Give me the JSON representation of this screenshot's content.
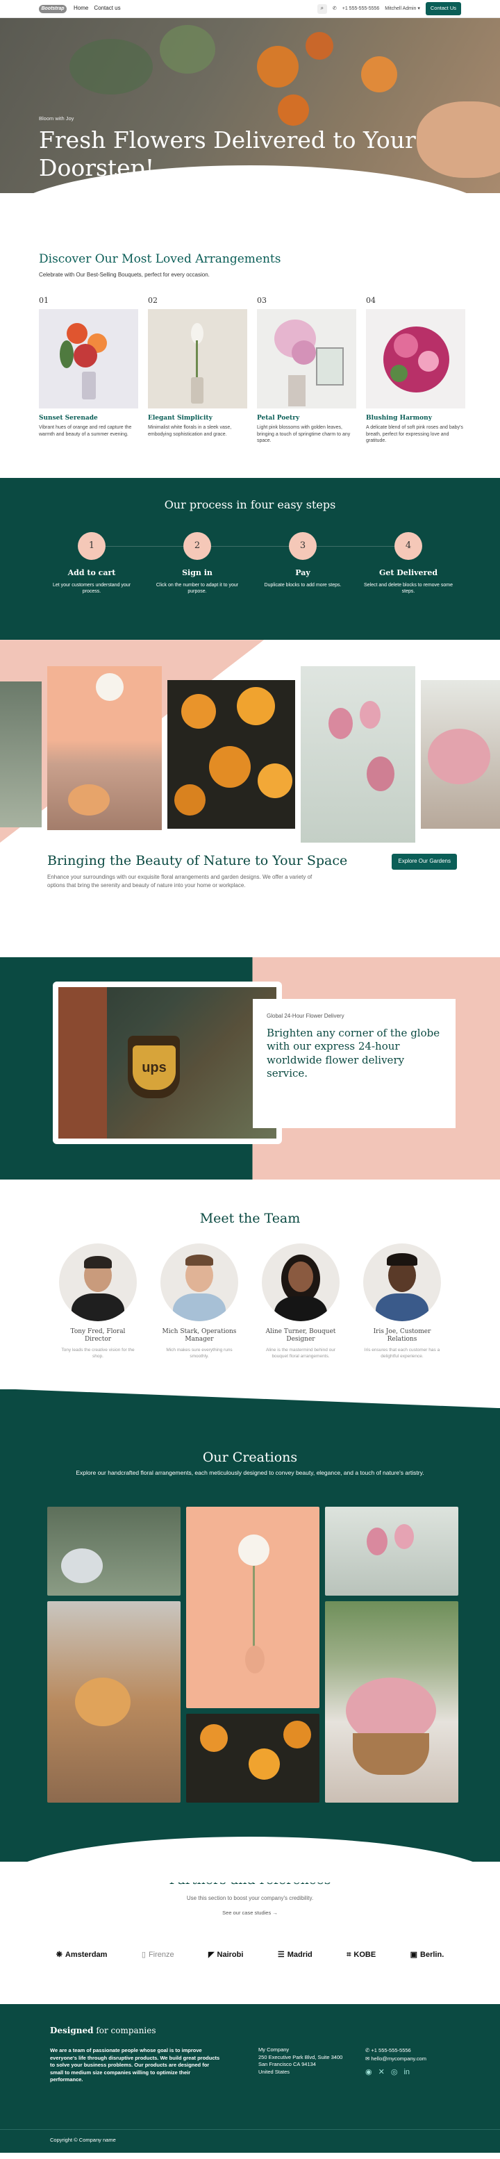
{
  "header": {
    "logo": "Bootstrap",
    "nav": [
      "Home",
      "Contact us"
    ],
    "phone": "+1 555-555-5556",
    "admin": "Mitchell Admin",
    "cta": "Contact Us"
  },
  "hero": {
    "sub": "Bloom with Joy",
    "title": "Fresh Flowers Delivered to Your Doorstep!"
  },
  "arrangements": {
    "title": "Discover Our Most Loved Arrangements",
    "subtitle": "Celebrate with Our Best-Selling Bouquets, perfect for every occasion.",
    "items": [
      {
        "num": "01",
        "title": "Sunset Serenade",
        "desc": "Vibrant hues of orange and red capture the warmth and beauty of a summer evening."
      },
      {
        "num": "02",
        "title": "Elegant Simplicity",
        "desc": "Minimalist white florals in a sleek vase, embodying sophistication and grace."
      },
      {
        "num": "03",
        "title": "Petal Poetry",
        "desc": "Light pink blossoms with golden leaves, bringing a touch of springtime charm to any space."
      },
      {
        "num": "04",
        "title": "Blushing Harmony",
        "desc": "A delicate blend of soft pink roses and baby's breath, perfect for expressing love and gratitude."
      }
    ]
  },
  "process": {
    "title": "Our process in four easy steps",
    "steps": [
      {
        "n": "1",
        "title": "Add to cart",
        "desc": "Let your customers understand your process."
      },
      {
        "n": "2",
        "title": "Sign in",
        "desc": "Click on the number to adapt it to your purpose."
      },
      {
        "n": "3",
        "title": "Pay",
        "desc": "Duplicate blocks to add more steps."
      },
      {
        "n": "4",
        "title": "Get Delivered",
        "desc": "Select and delete blocks to remove some steps."
      }
    ]
  },
  "beauty": {
    "title": "Bringing the Beauty of Nature to Your Space",
    "text": "Enhance your surroundings with our exquisite floral arrangements and garden designs. We offer a variety of options that bring the serenity and beauty of nature into your home or workplace.",
    "button": "Explore Our Gardens"
  },
  "delivery": {
    "small": "Global 24-Hour Flower Delivery",
    "big": "Brighten any corner of the globe with our express 24-hour worldwide flower delivery service.",
    "sign": "ups"
  },
  "team": {
    "title": "Meet the Team",
    "members": [
      {
        "name": "Tony Fred, Floral Director",
        "role": "Tony leads the creative vision for the shop."
      },
      {
        "name": "Mich Stark, Operations Manager",
        "role": "Mich makes sure everything runs smoothly."
      },
      {
        "name": "Aline Turner, Bouquet Designer",
        "role": "Aline is the mastermind behind our bouquet floral arrangements."
      },
      {
        "name": "Iris Joe, Customer Relations",
        "role": "Iris ensures that each customer has a delightful experience."
      }
    ]
  },
  "creations": {
    "title": "Our Creations",
    "subtitle": "Explore our handcrafted floral arrangements, each meticulously designed to convey beauty, elegance, and a touch of nature's artistry."
  },
  "partners": {
    "title": "Partners and references",
    "subtitle": "Use this section to boost your company's credibility.",
    "link": "See our case studies",
    "logos": [
      "Amsterdam",
      "Firenze",
      "Nairobi",
      "Madrid",
      "KOBE",
      "Berlin."
    ]
  },
  "footer": {
    "brand_bold": "Designed",
    "brand_rest": "for companies",
    "text": "We are a team of passionate people whose goal is to improve everyone's life through disruptive products. We build great products to solve your business problems. Our products are designed for small to medium size companies willing to optimize their performance.",
    "company": "My Company",
    "address1": "250 Executive Park Blvd, Suite 3400",
    "address2": "San Francisco CA 94134",
    "address3": "United States",
    "phone": "+1 555-555-5556",
    "email": "hello@mycompany.com",
    "copyright": "Copyright © Company name"
  },
  "colors": {
    "accent": "#0b5e57",
    "dark": "#0b4a42",
    "peach": "#f5c8b8"
  }
}
